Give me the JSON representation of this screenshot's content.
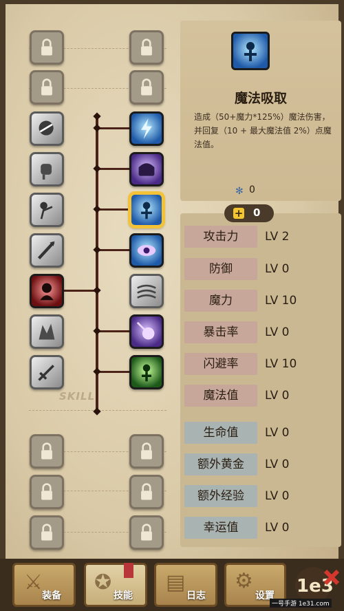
{
  "detail": {
    "icon": "mana-drain-skill-icon",
    "title": "魔法吸取",
    "description": "造成（50+魔力*125%）魔法伤害，并回复（10 + 最大魔法值 2%）点魔法值。",
    "points_icon": "skill-point-icon",
    "points_value": "0"
  },
  "stat_points": {
    "icon": "plus-icon",
    "value": "0"
  },
  "stats": [
    {
      "name": "攻击力",
      "level": "LV 2",
      "color": "#c7a79a"
    },
    {
      "name": "防御",
      "level": "LV 0",
      "color": "#c7a79a"
    },
    {
      "name": "魔力",
      "level": "LV 10",
      "color": "#c7a79a"
    },
    {
      "name": "暴击率",
      "level": "LV 0",
      "color": "#c7a79a"
    },
    {
      "name": "闪避率",
      "level": "LV 10",
      "color": "#c7a79a"
    },
    {
      "name": "魔法值",
      "level": "LV 0",
      "color": "#c7a79a"
    },
    {
      "name": "生命值",
      "level": "LV 0",
      "color": "#a9b3b1"
    },
    {
      "name": "额外黄金",
      "level": "LV 0",
      "color": "#a9b3b1"
    },
    {
      "name": "额外经验",
      "level": "LV 0",
      "color": "#a9b3b1"
    },
    {
      "name": "幸运值",
      "level": "LV 0",
      "color": "#a9b3b1"
    }
  ],
  "skill_tree": {
    "label": "SKILL",
    "left_column": [
      "lock-icon",
      "lock-icon",
      "roar-skill-icon",
      "fist-skill-icon",
      "strike-skill-icon",
      "pierce-skill-icon",
      "shadow-warrior-skill-icon",
      "rage-skill-icon",
      "sword-skill-icon",
      "lock-icon",
      "lock-icon",
      "lock-icon"
    ],
    "right_column": [
      "lock-icon",
      "lock-icon",
      "lightning-skill-icon",
      "chest-skill-icon",
      "mana-drain-skill-icon",
      "eye-skill-icon",
      "wind-skill-icon",
      "meteor-skill-icon",
      "heal-skill-icon",
      "lock-icon",
      "lock-icon",
      "lock-icon"
    ],
    "selected": "mana-drain-skill-icon"
  },
  "tabs": [
    {
      "label": "装备",
      "icon": "equipment-icon",
      "active": false
    },
    {
      "label": "技能",
      "icon": "skill-tab-icon",
      "active": true
    },
    {
      "label": "日志",
      "icon": "log-icon",
      "active": false
    },
    {
      "label": "设置",
      "icon": "settings-icon",
      "active": false
    }
  ],
  "watermark": "一号手游 1e31.com",
  "colors": {
    "accent_gold": "#f3c236",
    "panel": "#c9b892",
    "line": "#4a2218"
  }
}
